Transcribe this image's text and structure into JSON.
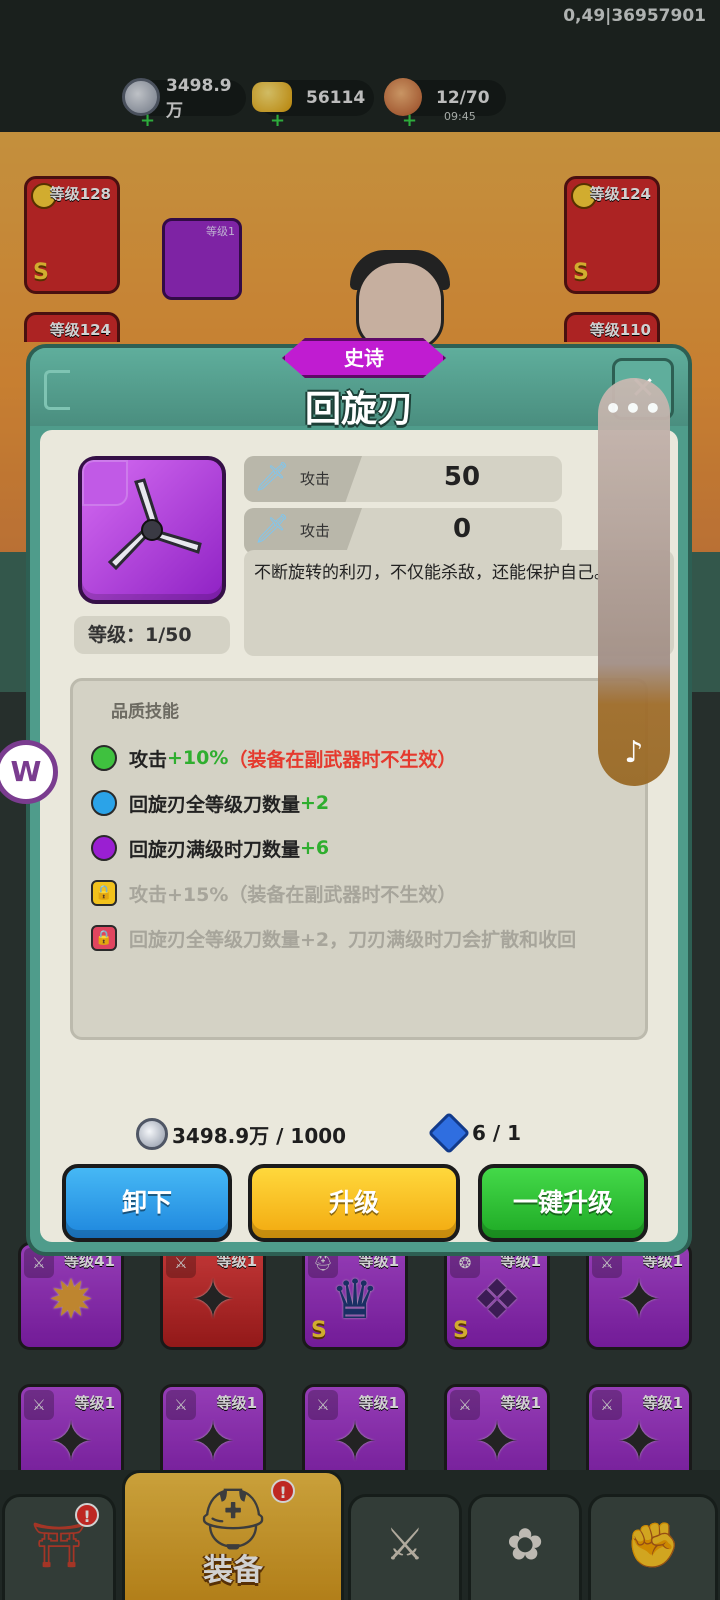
{
  "status": {
    "debug_id": "0,49|36957901"
  },
  "resources": {
    "silver": "3498.9万",
    "gold": "56114",
    "stamina": "12/70",
    "stamina_timer": "09:45",
    "plus": "+"
  },
  "scene": {
    "left_card_level": "等级128",
    "right_card_level": "等级124",
    "left_card2_level": "等级124",
    "right_card2_level": "等级110",
    "small_slot_level": "等级1",
    "grade_s": "S"
  },
  "modal": {
    "rarity": "史诗",
    "title": "回旋刃",
    "level": "等级：1/50",
    "stats": [
      {
        "label": "攻击",
        "value": "50"
      },
      {
        "label": "攻击",
        "value": "0"
      }
    ],
    "description": "不断旋转的利刃，不仅能杀敌，还能保护自己。",
    "skills_title": "品质技能",
    "skills": [
      {
        "base": "攻击",
        "bonus": "+10%",
        "note": "（装备在副武器时不生效）",
        "color": "#3fc13f"
      },
      {
        "base": "回旋刃全等级刀数量",
        "bonus": "+2",
        "note": "",
        "color": "#2ba3e8"
      },
      {
        "base": "回旋刃满级时刀数量",
        "bonus": "+6",
        "note": "",
        "color": "#9a1fd2"
      },
      {
        "base": "攻击+15%（装备在副武器时不生效）",
        "bonus": "",
        "note": "",
        "color": "#f2c21c"
      },
      {
        "base": "回旋刃全等级刀数量+2，刀刃满级时刀会扩散和收回",
        "bonus": "",
        "note": "",
        "color": "#e0455f"
      }
    ],
    "cost_silver": "3498.9万 / 1000",
    "cost_gem": "6 / 1",
    "buttons": {
      "unequip": "卸下",
      "upgrade": "升级",
      "upgrade_all": "一键升级"
    }
  },
  "grid": {
    "row1": [
      "等级41",
      "等级1",
      "等级1",
      "等级1",
      "等级1"
    ],
    "row2": [
      "等级1",
      "等级1",
      "等级1",
      "等级1",
      "等级1"
    ]
  },
  "nav": {
    "active_label": "装备",
    "badge": "!"
  },
  "float": {
    "more": "•••",
    "music": "♪",
    "w_badge": "W"
  },
  "icons": [
    "silver-coin-icon",
    "gold-ingot-icon",
    "meat-icon",
    "sword-icon",
    "lock-icon",
    "music-note-icon",
    "more-icon",
    "shuriken-icon"
  ]
}
